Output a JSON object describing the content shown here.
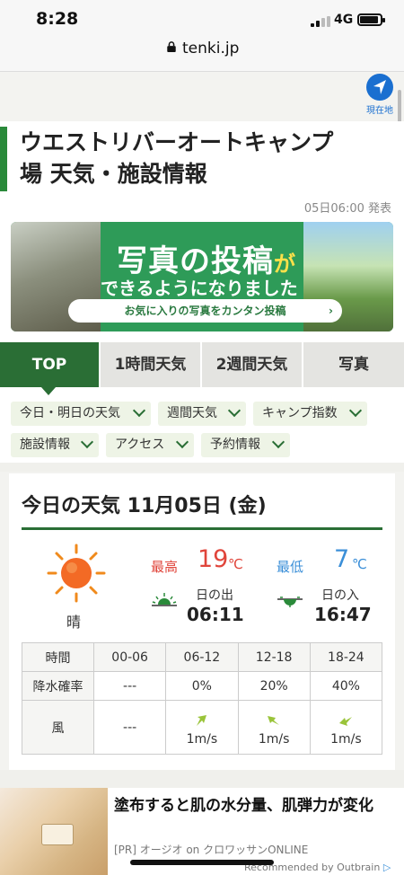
{
  "status": {
    "time": "8:28",
    "network": "4G"
  },
  "url": "tenki.jp",
  "location_button": {
    "label": "現在地"
  },
  "page": {
    "title_line1": "ウエストリバーオートキャンプ",
    "title_line2": "場 天気・施設情報",
    "issued": "05日06:00 発表"
  },
  "banner": {
    "headline_main": "写真の投稿",
    "headline_suffix": "が",
    "subline": "できるようになりました",
    "cta": "お気に入りの写真をカンタン投稿"
  },
  "tabs": [
    {
      "label": "TOP",
      "active": true
    },
    {
      "label": "1時間天気",
      "active": false
    },
    {
      "label": "2週間天気",
      "active": false
    },
    {
      "label": "写真",
      "active": false
    }
  ],
  "submenu": [
    {
      "label": "今日・明日の天気"
    },
    {
      "label": "週間天気"
    },
    {
      "label": "キャンプ指数"
    },
    {
      "label": "施設情報"
    },
    {
      "label": "アクセス"
    },
    {
      "label": "予約情報"
    }
  ],
  "weather": {
    "heading": "今日の天気 11月05日 (金)",
    "condition": "晴",
    "max_label": "最高",
    "max_value": "19",
    "min_label": "最低",
    "min_value": "7",
    "unit": "℃",
    "sunrise_label": "日の出",
    "sunrise": "06:11",
    "sunset_label": "日の入",
    "sunset": "16:47",
    "table": {
      "time_label": "時間",
      "periods": [
        "00-06",
        "06-12",
        "12-18",
        "18-24"
      ],
      "precip_label": "降水確率",
      "precip": [
        "---",
        "0%",
        "20%",
        "40%"
      ],
      "wind_label": "風",
      "wind": [
        "---",
        "1m/s",
        "1m/s",
        "1m/s"
      ]
    }
  },
  "colors": {
    "brand_green": "#2a6e35",
    "max_red": "#e0453b",
    "min_blue": "#3b8fd8"
  },
  "ad": {
    "title": "塗布すると肌の水分量、肌弾力が変化",
    "source": "[PR] オージオ on クロワッサンONLINE",
    "recommended": "Recommended by Outbrain"
  }
}
